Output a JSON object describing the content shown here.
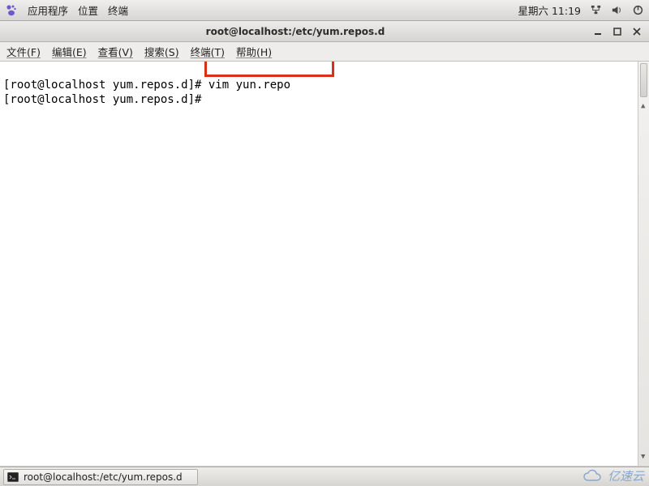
{
  "top_panel": {
    "menus": {
      "apps": "应用程序",
      "places": "位置",
      "terminal": "终端"
    },
    "clock": "星期六 11:19"
  },
  "window": {
    "title": "root@localhost:/etc/yum.repos.d"
  },
  "term_menu": {
    "file": "文件(F)",
    "edit": "编辑(E)",
    "view": "查看(V)",
    "search": "搜索(S)",
    "terminal": "终端(T)",
    "help": "帮助(H)"
  },
  "terminal": {
    "line1_prompt": "[root@localhost yum.repos.d]#",
    "line1_cmd": " vim yun.repo",
    "line2_prompt": "[root@localhost yum.repos.d]#",
    "line2_cmd": " "
  },
  "taskbar": {
    "item1": "root@localhost:/etc/yum.repos.d"
  },
  "watermark": {
    "text": "亿速云"
  }
}
